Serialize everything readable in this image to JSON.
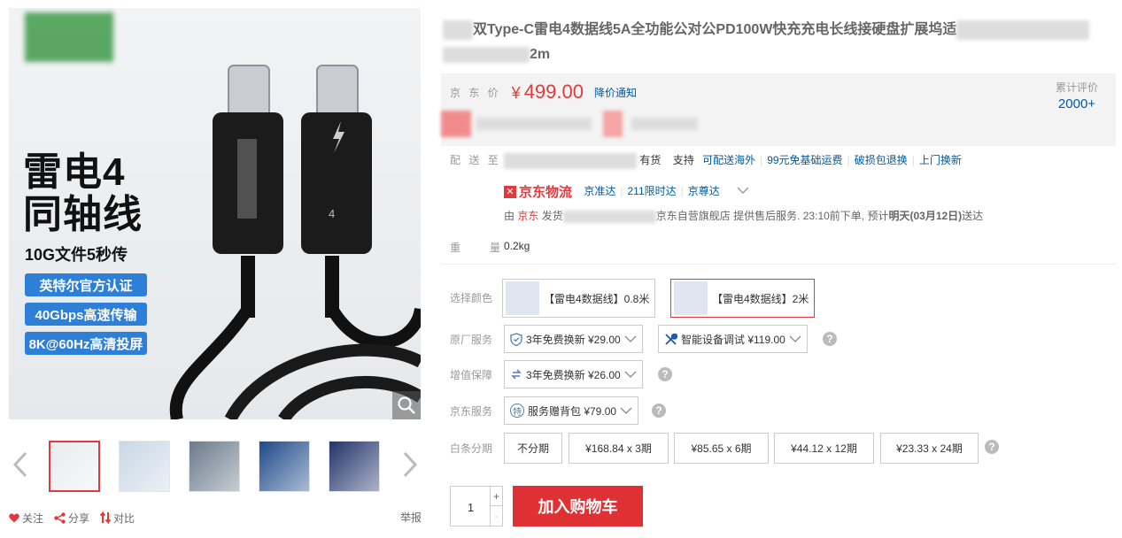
{
  "gallery": {
    "hero_title_line1": "雷电4",
    "hero_title_line2": "同轴线",
    "hero_sub": "10G文件5秒传",
    "badges": [
      "英特尔官方认证",
      "40Gbps高速传输",
      "8K@60Hz高清投屏"
    ],
    "connector_number": "4",
    "thumbnail_count": 5,
    "thumb_colors": [
      "#e8ecef",
      "#c9d7e6",
      "#6b7a8c",
      "#1f4a8a",
      "#23336b"
    ]
  },
  "actions": {
    "follow": "关注",
    "share": "分享",
    "compare": "对比",
    "report": "举报"
  },
  "product": {
    "title_part1": "双Type-C雷电4数据线5A全功能公对公PD100W快充充电长线接硬盘扩展坞适",
    "title_part2": "2m"
  },
  "price": {
    "label": "京 东 价",
    "currency": "¥",
    "value": "499.00",
    "notify": "降价通知",
    "rating_label": "累计评价",
    "rating_value": "2000+"
  },
  "delivery": {
    "label": "配 送 至",
    "stock": "有货",
    "support_label": "支持",
    "services": [
      "可配送海外",
      "99元免基础运费",
      "破损包退换",
      "上门换新"
    ],
    "logistics_brand": "京东物流",
    "logistics_options": [
      "京准达",
      "211限时达",
      "京尊达"
    ],
    "ship_prefix": "由",
    "ship_from": "京东",
    "ship_mid": "发货",
    "ship_store": "京东自营旗舰店",
    "ship_text": "提供售后服务. 23:10前下单, 预计",
    "ship_date": "明天(03月12日)",
    "ship_suffix": "送达"
  },
  "weight": {
    "label": "重　　量",
    "value": "0.2kg"
  },
  "color": {
    "label": "选择颜色",
    "options": [
      "【雷电4数据线】0.8米",
      "【雷电4数据线】2米"
    ],
    "selected_index": 1
  },
  "factory_service": {
    "label": "原厂服务",
    "options": [
      "3年免费换新 ¥29.00",
      "智能设备调试 ¥119.00"
    ]
  },
  "value_added": {
    "label": "增值保障",
    "option": "3年免费换新 ¥26.00"
  },
  "jd_service": {
    "label": "京东服务",
    "option": "服务赠背包 ¥79.00",
    "badge": "特"
  },
  "installments": {
    "label": "白条分期",
    "options": [
      "不分期",
      "¥168.84 x 3期",
      "¥85.65 x 6期",
      "¥44.12 x 12期",
      "¥23.33 x 24期"
    ]
  },
  "cart": {
    "quantity": "1",
    "plus": "+",
    "minus": "-",
    "add_to_cart": "加入购物车"
  },
  "help_mark": "?",
  "colors": {
    "accent_red": "#e4393c",
    "link_blue": "#005aa0",
    "badge_blue": "#2e7fd8"
  }
}
